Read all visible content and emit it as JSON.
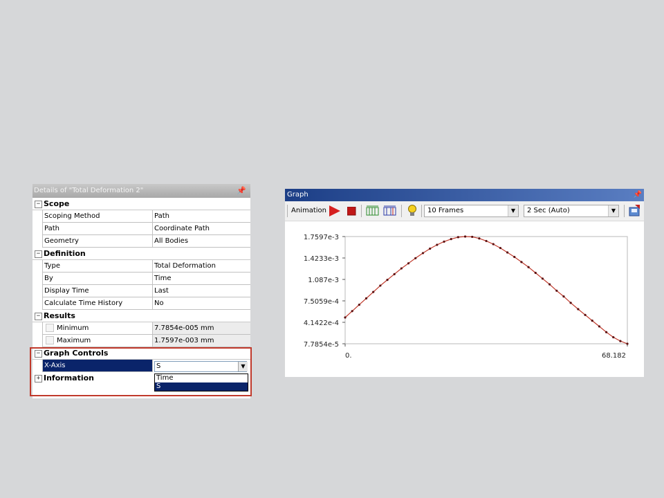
{
  "details": {
    "title": "Details of \"Total Deformation 2\"",
    "pin": "p",
    "sections": {
      "scope": {
        "label": "Scope",
        "toggle": "−",
        "scoping_method": {
          "name": "Scoping Method",
          "value": "Path"
        },
        "path": {
          "name": "Path",
          "value": "Coordinate Path"
        },
        "geometry": {
          "name": "Geometry",
          "value": "All Bodies"
        }
      },
      "definition": {
        "label": "Definition",
        "toggle": "−",
        "type": {
          "name": "Type",
          "value": "Total Deformation"
        },
        "by": {
          "name": "By",
          "value": "Time"
        },
        "display_time": {
          "name": "Display Time",
          "value": "Last"
        },
        "calc_history": {
          "name": "Calculate Time History",
          "value": "No"
        }
      },
      "results": {
        "label": "Results",
        "toggle": "−",
        "minimum": {
          "name": "Minimum",
          "value": "7.7854e-005 mm"
        },
        "maximum": {
          "name": "Maximum",
          "value": "1.7597e-003 mm"
        }
      },
      "graph_controls": {
        "label": "Graph Controls",
        "toggle": "−",
        "x_axis": {
          "name": "X-Axis",
          "value": "S",
          "options": [
            "Time",
            "S"
          ],
          "selected": "S"
        }
      },
      "information": {
        "label": "Information",
        "toggle": "+"
      }
    }
  },
  "graph": {
    "title": "Graph",
    "toolbar": {
      "animation_label": "Animation",
      "frames": "10 Frames",
      "duration": "2 Sec (Auto)"
    },
    "colors": {
      "curve": "#c0392b",
      "play": "#d62020",
      "title_bar": "#1c3e86"
    },
    "chart_data": {
      "type": "line",
      "x_tick_labels": [
        "0.",
        "68.182"
      ],
      "y_tick_labels": [
        "1.7597e-3",
        "1.4233e-3",
        "1.087e-3",
        "7.5059e-4",
        "4.1422e-4",
        "7.7854e-5"
      ],
      "xlim": [
        0,
        68.182
      ],
      "ylim": [
        7.7854e-05,
        0.0017597
      ],
      "grid": false,
      "series": [
        {
          "x": [
            0,
            1.7,
            3.4,
            5.1,
            6.8,
            8.5,
            10.2,
            11.9,
            13.6,
            15.3,
            17.0,
            18.8,
            20.5,
            22.2,
            23.9,
            25.6,
            27.3,
            29.0,
            30.7,
            32.4,
            34.1,
            35.8,
            37.5,
            39.2,
            40.9,
            42.6,
            44.3,
            46.0,
            47.7,
            49.4,
            51.1,
            52.8,
            54.5,
            56.3,
            58.0,
            59.7,
            61.4,
            63.1,
            64.8,
            66.5,
            68.182
          ],
          "y": [
            0.00049,
            0.00059,
            0.00069,
            0.00079,
            0.00089,
            0.00099,
            0.00108,
            0.00117,
            0.00126,
            0.00134,
            0.00142,
            0.0015,
            0.00157,
            0.00163,
            0.00168,
            0.00172,
            0.00175,
            0.0017597,
            0.001755,
            0.00173,
            0.00169,
            0.00164,
            0.00158,
            0.00151,
            0.00144,
            0.00136,
            0.00128,
            0.00119,
            0.0011,
            0.00101,
            0.00091,
            0.00082,
            0.00072,
            0.00062,
            0.00053,
            0.00044,
            0.00035,
            0.00026,
            0.00018,
            0.00012,
            7.7854e-05
          ]
        }
      ]
    }
  }
}
